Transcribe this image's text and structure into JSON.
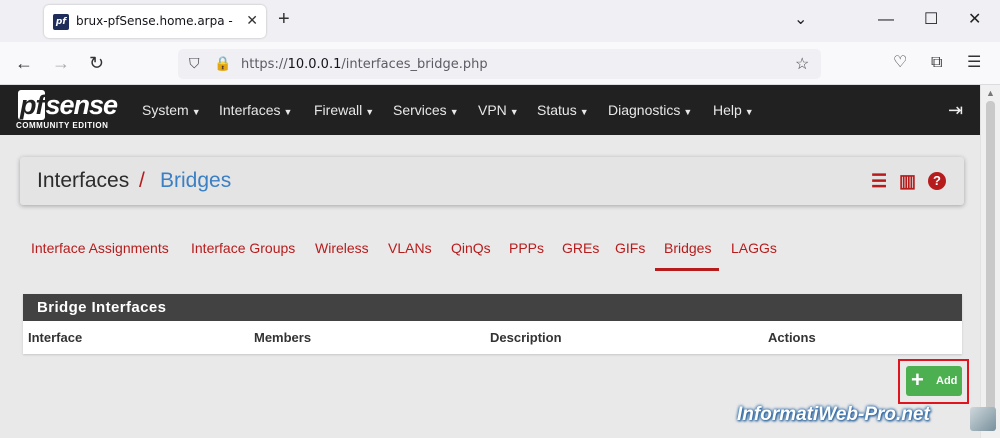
{
  "browser": {
    "tab_title": "brux-pfSense.home.arpa - Interfaces: Bridges",
    "tab_favicon_text": "pf",
    "url_prefix": "https://",
    "url_host": "10.0.0.1",
    "url_path": "/interfaces_bridge.php"
  },
  "navbar": {
    "logo_main_pf": "pf",
    "logo_main_rest": "sense",
    "logo_sub": "COMMUNITY EDITION",
    "menus": [
      "System",
      "Interfaces",
      "Firewall",
      "Services",
      "VPN",
      "Status",
      "Diagnostics",
      "Help"
    ]
  },
  "breadcrumb": {
    "section": "Interfaces",
    "separator": "/",
    "page": "Bridges"
  },
  "tabs": [
    {
      "label": "Interface Assignments",
      "active": false
    },
    {
      "label": "Interface Groups",
      "active": false
    },
    {
      "label": "Wireless",
      "active": false
    },
    {
      "label": "VLANs",
      "active": false
    },
    {
      "label": "QinQs",
      "active": false
    },
    {
      "label": "PPPs",
      "active": false
    },
    {
      "label": "GREs",
      "active": false
    },
    {
      "label": "GIFs",
      "active": false
    },
    {
      "label": "Bridges",
      "active": true
    },
    {
      "label": "LAGGs",
      "active": false
    }
  ],
  "panel": {
    "title": "Bridge Interfaces",
    "columns": [
      "Interface",
      "Members",
      "Description",
      "Actions"
    ]
  },
  "add_button": {
    "label": "Add"
  },
  "watermark": "InformatiWeb-Pro.net",
  "colors": {
    "accent_red": "#b71c1c",
    "link_blue": "#3b7fc4",
    "navbar_bg": "#212121",
    "add_green": "#4caf50",
    "highlight_red": "#e0141e"
  },
  "icons": {
    "toolbar": [
      "back-icon",
      "forward-icon",
      "reload-icon",
      "shield-icon",
      "lock-icon",
      "bookmark-star-icon",
      "pocket-icon",
      "extensions-icon",
      "menu-icon"
    ],
    "breadcrumb": [
      "sliders-icon",
      "chart-icon",
      "help-icon"
    ]
  }
}
